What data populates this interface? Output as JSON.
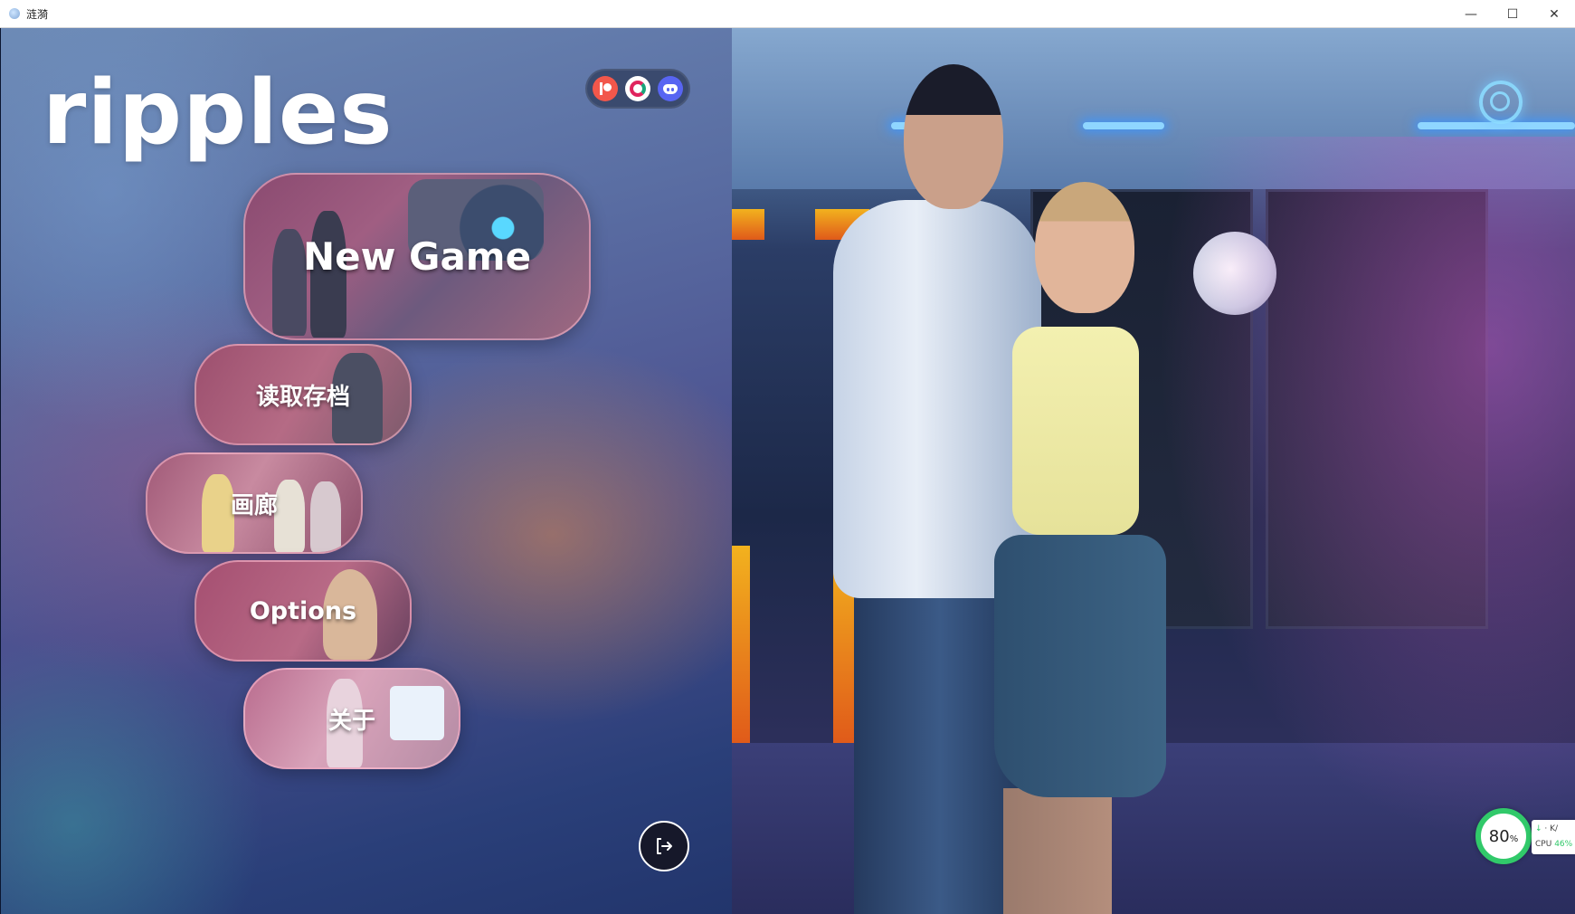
{
  "window": {
    "title": "涟漪",
    "minimize_glyph": "—",
    "maximize_glyph": "☐",
    "close_glyph": "✕"
  },
  "game": {
    "logo": "ripples",
    "social_icons": [
      "patreon-icon",
      "subscribestar-icon",
      "discord-icon"
    ],
    "menu": {
      "new_game": "New Game",
      "load": "读取存档",
      "gallery": "画廊",
      "options": "Options",
      "about": "关于"
    },
    "exit_icon": "exit-door-icon"
  },
  "system_monitor": {
    "percent": "80",
    "percent_unit": "%",
    "net_label": "· K/",
    "cpu_label": "CPU",
    "cpu_value": "46%"
  },
  "colors": {
    "accent_pink": "#b86a86",
    "monitor_green": "#31c96a"
  }
}
